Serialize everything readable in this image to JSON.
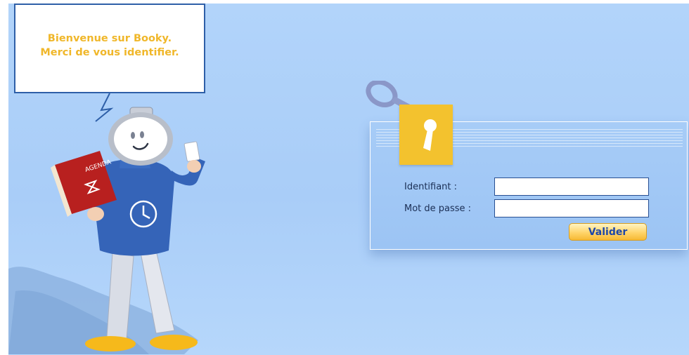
{
  "welcome": {
    "line1": "Bienvenue sur Booky.",
    "line2": "Merci de vous identifier."
  },
  "mascot": {
    "book_label": "AGENDA",
    "icons": [
      "mascot-illustration",
      "agenda-book-icon",
      "clock-icon",
      "hourglass-icon"
    ]
  },
  "login": {
    "identifiant_label": "Identifiant :",
    "identifiant_value": "",
    "password_label": "Mot de passe :",
    "password_value": "",
    "submit_label": "Valider",
    "icons": [
      "key-icon",
      "keyhole-icon"
    ]
  },
  "colors": {
    "background": "#a9cdf8",
    "welcome_text": "#f0b72a",
    "bubble_border": "#2e5fa8",
    "lock_tile": "#f3c22e",
    "button": "#ffd46a",
    "button_text": "#1e47a8"
  }
}
